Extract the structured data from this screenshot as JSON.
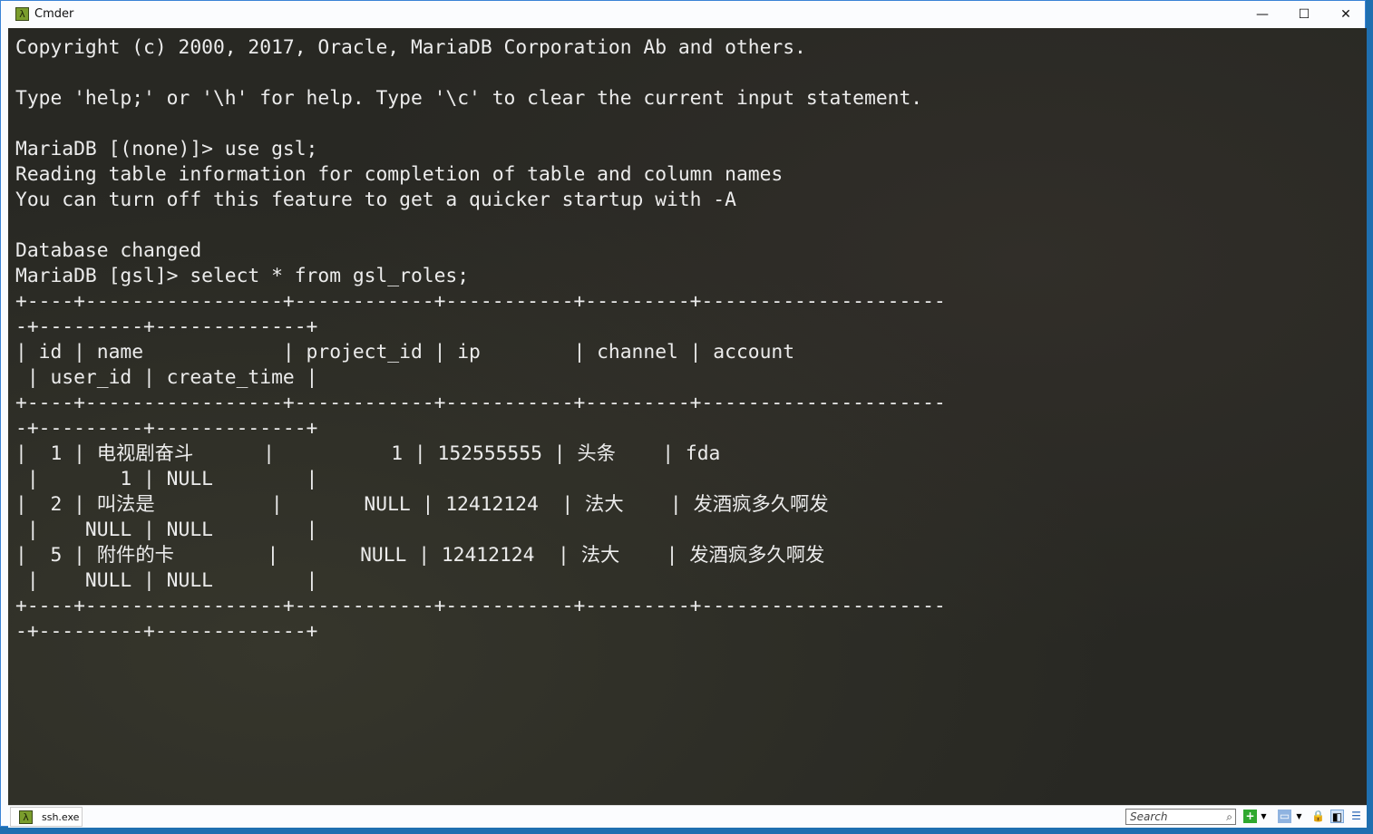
{
  "window": {
    "title": "Cmder",
    "icon": "lambda-icon"
  },
  "controls": {
    "minimize": "—",
    "maximize": "☐",
    "close": "✕"
  },
  "terminal": {
    "lines": [
      "Copyright (c) 2000, 2017, Oracle, MariaDB Corporation Ab and others.",
      "",
      "Type 'help;' or '\\h' for help. Type '\\c' to clear the current input statement.",
      "",
      "MariaDB [(none)]> use gsl;",
      "Reading table information for completion of table and column names",
      "You can turn off this feature to get a quicker startup with -A",
      "",
      "Database changed",
      "MariaDB [gsl]> select * from gsl_roles;",
      "+----+-----------------+------------+-----------+---------+---------------------",
      "-+---------+-------------+",
      "| id | name            | project_id | ip        | channel | account",
      " | user_id | create_time |",
      "+----+-----------------+------------+-----------+---------+---------------------",
      "-+---------+-------------+",
      "|  1 | 电视剧奋斗      |          1 | 152555555 | 头条    | fda",
      " |       1 | NULL        |",
      "|  2 | 叫法是          |       NULL | 12412124  | 法大    | 发酒疯多久啊发",
      " |    NULL | NULL        |",
      "|  5 | 附件的卡        |       NULL | 12412124  | 法大    | 发酒疯多久啊发",
      " |    NULL | NULL        |",
      "+----+-----------------+------------+-----------+---------+---------------------",
      "-+---------+-------------+"
    ]
  },
  "statusbar": {
    "tab_label": "ssh.exe",
    "search_placeholder": "Search",
    "icons": [
      "new-console-icon",
      "dropdown-icon",
      "console-list-icon",
      "dropdown-icon",
      "lock-icon",
      "split-view-icon",
      "menu-icon"
    ]
  },
  "colors": {
    "terminal_bg": "#282823",
    "terminal_fg": "#ececec",
    "accent": "#3b84d6"
  }
}
